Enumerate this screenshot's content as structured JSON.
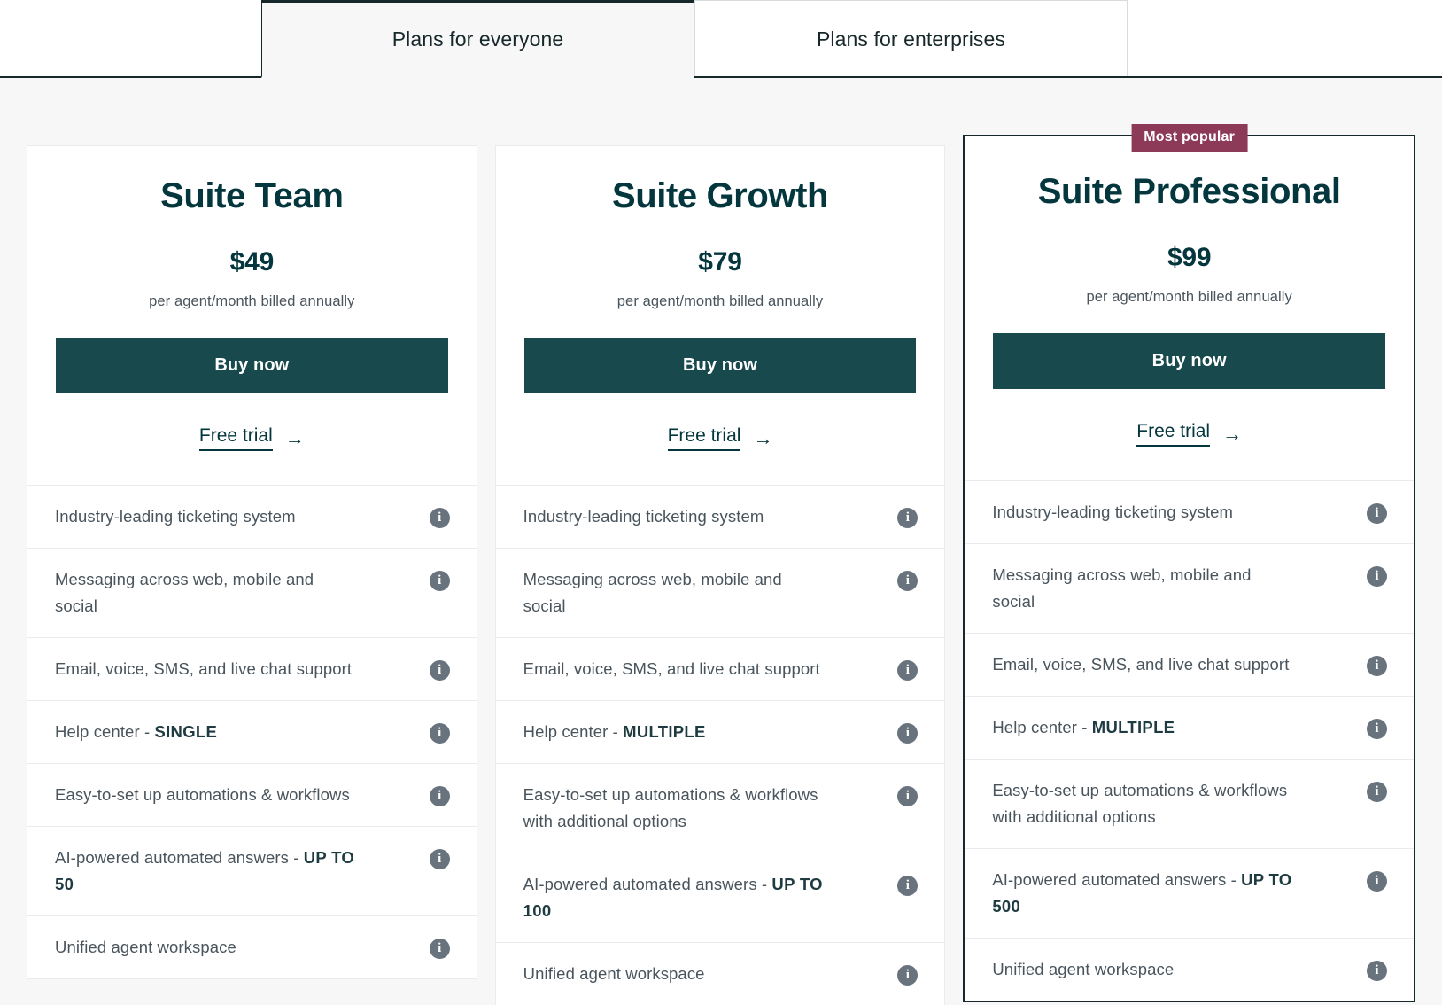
{
  "tabs": [
    {
      "label": "Plans for everyone",
      "active": true
    },
    {
      "label": "Plans for enterprises",
      "active": false
    }
  ],
  "colors": {
    "accent_teal": "#17494d",
    "title_teal": "#03363d",
    "badge_maroon": "#8c3a57",
    "page_background": "#f7f7f7",
    "border_dark": "#17282b",
    "info_icon_gray": "#68737d"
  },
  "icons": {
    "info": "info-icon",
    "arrow_right": "arrow-right-icon"
  },
  "common": {
    "billing_note": "per agent/month billed annually",
    "buy_label": "Buy now",
    "trial_label": "Free trial",
    "trial_arrow": "→",
    "info_glyph": "i"
  },
  "plans": [
    {
      "name": "Suite Team",
      "price": "$49",
      "billing": "per agent/month billed annually",
      "buy_label": "Buy now",
      "trial_label": "Free trial",
      "featured": false,
      "badge": null,
      "features": [
        {
          "text": "Industry-leading ticketing system",
          "emphasis": null
        },
        {
          "text": "Messaging across web, mobile and social",
          "emphasis": null
        },
        {
          "text": "Email, voice, SMS, and live chat support",
          "emphasis": null
        },
        {
          "text": "Help center - ",
          "emphasis": "SINGLE"
        },
        {
          "text": "Easy-to-set up automations & workflows",
          "emphasis": null
        },
        {
          "text": "AI-powered automated answers - ",
          "emphasis": "UP TO 50"
        },
        {
          "text": "Unified agent workspace",
          "emphasis": null
        }
      ]
    },
    {
      "name": "Suite Growth",
      "price": "$79",
      "billing": "per agent/month billed annually",
      "buy_label": "Buy now",
      "trial_label": "Free trial",
      "featured": false,
      "badge": null,
      "features": [
        {
          "text": "Industry-leading ticketing system",
          "emphasis": null
        },
        {
          "text": "Messaging across web, mobile and social",
          "emphasis": null
        },
        {
          "text": "Email, voice, SMS, and live chat support",
          "emphasis": null
        },
        {
          "text": "Help center - ",
          "emphasis": "MULTIPLE"
        },
        {
          "text": "Easy-to-set up automations & workflows with additional options",
          "emphasis": null
        },
        {
          "text": "AI-powered automated answers - ",
          "emphasis": "UP TO 100"
        },
        {
          "text": "Unified agent workspace",
          "emphasis": null
        }
      ]
    },
    {
      "name": "Suite Professional",
      "price": "$99",
      "billing": "per agent/month billed annually",
      "buy_label": "Buy now",
      "trial_label": "Free trial",
      "featured": true,
      "badge": "Most popular",
      "features": [
        {
          "text": "Industry-leading ticketing system",
          "emphasis": null
        },
        {
          "text": "Messaging across web, mobile and social",
          "emphasis": null
        },
        {
          "text": "Email, voice, SMS, and live chat support",
          "emphasis": null
        },
        {
          "text": "Help center - ",
          "emphasis": "MULTIPLE"
        },
        {
          "text": "Easy-to-set up automations & workflows with additional options",
          "emphasis": null
        },
        {
          "text": "AI-powered automated answers - ",
          "emphasis": "UP TO 500"
        },
        {
          "text": "Unified agent workspace",
          "emphasis": null
        }
      ]
    }
  ]
}
